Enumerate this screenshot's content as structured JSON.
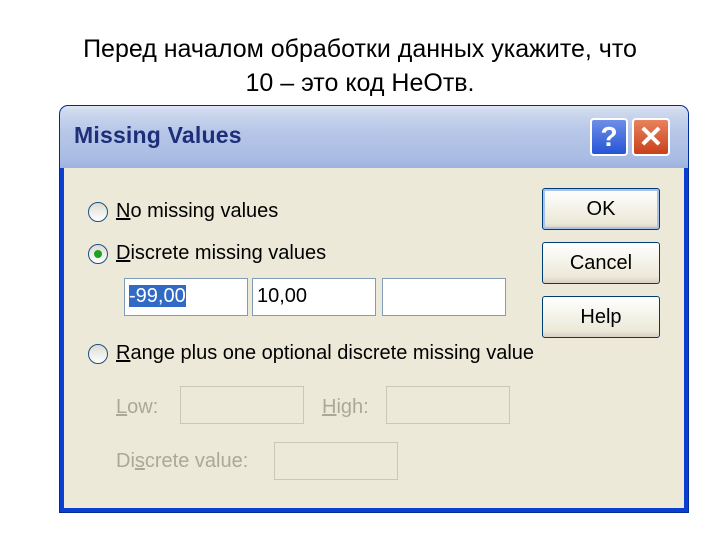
{
  "slide": {
    "line1": "Перед началом обработки данных укажите, что",
    "line2": "10 – это код НеОтв."
  },
  "dialog": {
    "title": "Missing Values",
    "help_glyph": "?",
    "close_glyph": "✕",
    "options": {
      "no_missing": {
        "accel": "N",
        "rest": "o missing values",
        "checked": false
      },
      "discrete": {
        "accel": "D",
        "rest": "iscrete missing values",
        "checked": true
      },
      "range": {
        "accel": "R",
        "rest": "ange plus one optional discrete missing value",
        "checked": false
      }
    },
    "discrete_values": [
      "-99,00",
      "10,00",
      ""
    ],
    "range_fields": {
      "low_accel": "L",
      "low_rest": "ow:",
      "high_accel": "H",
      "high_rest": "igh:",
      "discrete_pre": "Di",
      "discrete_accel": "s",
      "discrete_rest": "crete value:",
      "low_value": "",
      "high_value": "",
      "discrete_value": ""
    },
    "buttons": {
      "ok": "OK",
      "cancel": "Cancel",
      "help": "Help"
    },
    "colors": {
      "titlebar_text": "#1e2f7a",
      "frame": "#0a3fd0",
      "client": "#ece9d8",
      "selection": "#316ac5",
      "radio_dot": "#21a121"
    }
  }
}
